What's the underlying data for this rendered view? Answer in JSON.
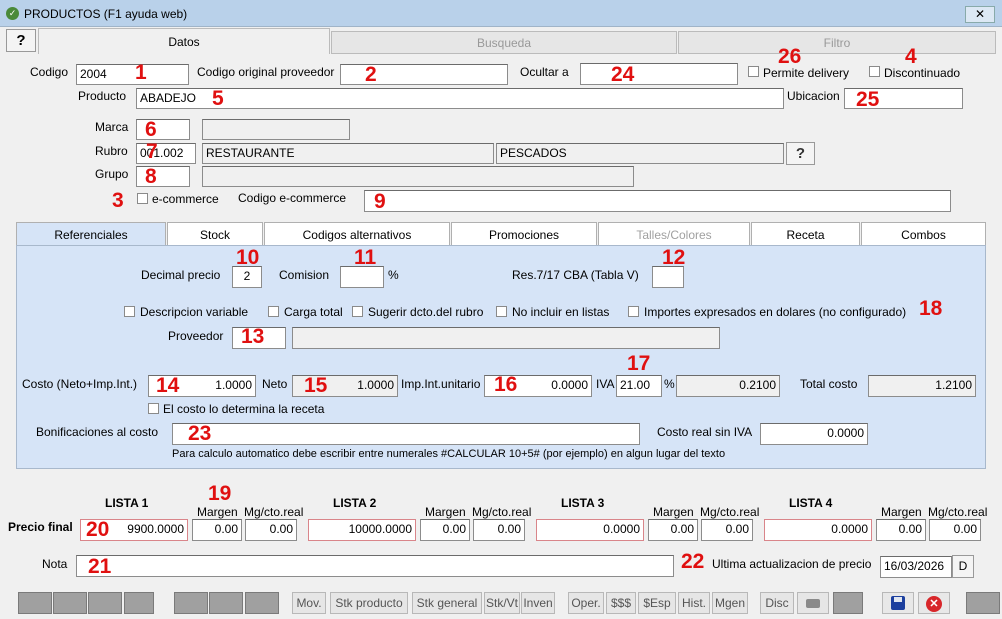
{
  "window": {
    "title": "PRODUCTOS (F1 ayuda web)"
  },
  "main_tabs": [
    "Datos",
    "Busqueda",
    "Filtro"
  ],
  "labels": {
    "codigo": "Codigo",
    "codigo_original": "Codigo original proveedor",
    "ocultar": "Ocultar a",
    "permite_delivery": "Permite delivery",
    "discontinuado": "Discontinuado",
    "producto": "Producto",
    "ubicacion": "Ubicacion",
    "marca": "Marca",
    "rubro": "Rubro",
    "grupo": "Grupo",
    "ecommerce": "e-commerce",
    "codigo_ecommerce": "Codigo e-commerce"
  },
  "values": {
    "codigo": "2004",
    "producto": "ABADEJO",
    "rubro_code": "001.002",
    "rubro_name": "RESTAURANTE",
    "rubro_sub": "PESCADOS"
  },
  "sub_tabs": [
    "Referenciales",
    "Stock",
    "Codigos alternativos",
    "Promociones",
    "Talles/Colores",
    "Receta",
    "Combos"
  ],
  "ref": {
    "decimal_precio_label": "Decimal precio",
    "decimal_precio": "2",
    "comision_label": "Comision",
    "pct": "%",
    "res_label": "Res.7/17 CBA (Tabla V)",
    "chk_desc_var": "Descripcion variable",
    "chk_carga_total": "Carga total",
    "chk_sugerir": "Sugerir dcto.del rubro",
    "chk_no_incluir": "No incluir en listas",
    "chk_dolares": "Importes expresados en dolares (no configurado)",
    "proveedor_label": "Proveedor",
    "costo_label": "Costo (Neto+Imp.Int.)",
    "costo": "1.0000",
    "neto_label": "Neto",
    "neto": "1.0000",
    "impint_label": "Imp.Int.unitario",
    "impint": "0.0000",
    "iva_label": "IVA",
    "iva": "21.00",
    "iva_pct": "%",
    "iva_amt": "0.2100",
    "total_costo_label": "Total costo",
    "total_costo": "1.2100",
    "chk_receta": "El costo lo determina la receta",
    "bonif_label": "Bonificaciones al costo",
    "costo_real_label": "Costo real sin IVA",
    "costo_real": "0.0000",
    "hint": "Para calculo automatico debe escribir entre numerales #CALCULAR 10+5# (por ejemplo) en algun lugar del texto"
  },
  "prices": {
    "row_label": "Precio final",
    "margen_label": "Margen",
    "mg_label": "Mg/cto.real",
    "lists": [
      {
        "name": "LISTA 1",
        "precio": "9900.0000",
        "margen": "0.00",
        "mg": "0.00"
      },
      {
        "name": "LISTA 2",
        "precio": "10000.0000",
        "margen": "0.00",
        "mg": "0.00"
      },
      {
        "name": "LISTA 3",
        "precio": "0.0000",
        "margen": "0.00",
        "mg": "0.00"
      },
      {
        "name": "LISTA 4",
        "precio": "0.0000",
        "margen": "0.00",
        "mg": "0.00"
      }
    ]
  },
  "nota_label": "Nota",
  "ultima_label": "Ultima actualizacion de precio",
  "ultima_fecha": "16/03/2026",
  "ultima_btn": "D",
  "toolbar": [
    "Mov.",
    "Stk producto",
    "Stk general",
    "Stk/Vt",
    "Inven",
    "Oper.",
    "$$$",
    "$Esp",
    "Hist.",
    "Mgen",
    "Disc"
  ],
  "markers": [
    "1",
    "2",
    "3",
    "4",
    "5",
    "6",
    "7",
    "8",
    "9",
    "10",
    "11",
    "12",
    "13",
    "14",
    "15",
    "16",
    "17",
    "18",
    "19",
    "20",
    "21",
    "22",
    "23",
    "24",
    "25",
    "26"
  ],
  "colors": {
    "marker": "#e01010",
    "panel": "#d6e4f7",
    "titlebar": "#b9d1ea"
  }
}
